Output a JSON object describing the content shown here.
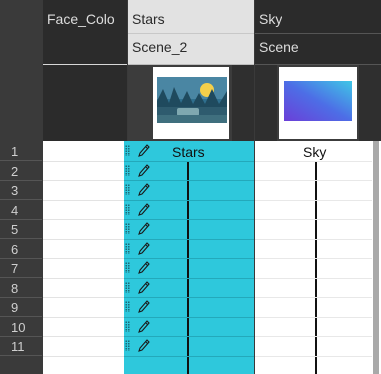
{
  "columns": [
    {
      "name": "Face_Colo",
      "subname": ""
    },
    {
      "name": "Stars",
      "subname": "Scene_2",
      "cell_label": "Stars",
      "thumbnail": "night-landscape-thumbnail"
    },
    {
      "name": "Sky",
      "subname": "Scene",
      "cell_label": "Sky",
      "thumbnail": "blue-gradient-thumbnail"
    }
  ],
  "frames": [
    "1",
    "2",
    "3",
    "4",
    "5",
    "6",
    "7",
    "8",
    "9",
    "10",
    "11"
  ],
  "icons": {
    "cell_edit": "pencil-icon",
    "drag": "drag-handle-icon"
  },
  "colors": {
    "selected_column": "#2ec8dc",
    "selected_header": "#e2e2e2",
    "dark_header": "#2b2b2b"
  }
}
